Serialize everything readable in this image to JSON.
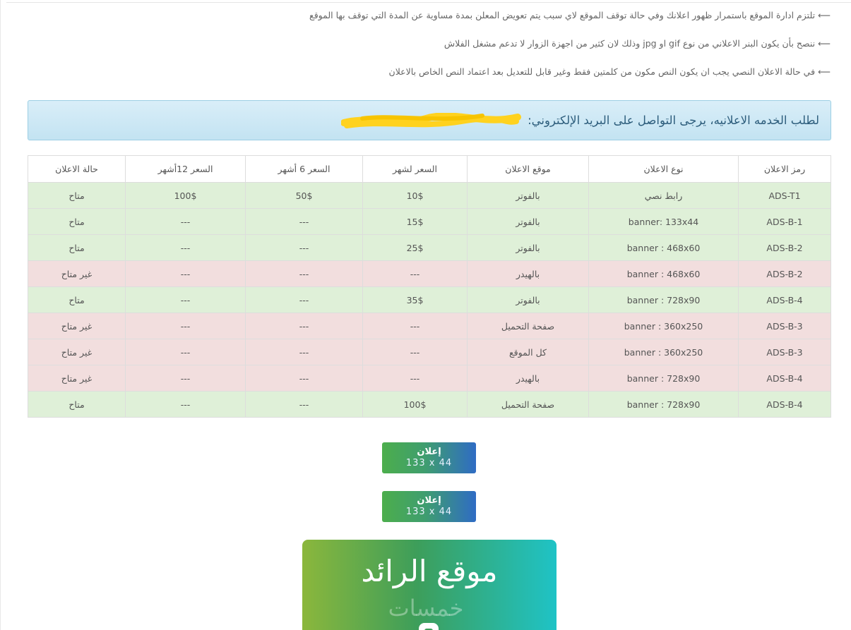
{
  "notes": [
    "تلتزم ادارة الموقع باستمرار ظهور اعلانك وفي حالة توقف الموقع لاي سبب يتم تعويض المعلن بمدة مساوية عن المدة التي توقف بها الموقع",
    "ننصح بأن يكون البنر الاعلاني من نوع gif او jpg وذلك لان كثير من اجهزة الزوار لا تدعم مشغل الفلاش",
    "في حالة الاعلان النصي يجب ان يكون النص مكون من كلمتين فقط وغير قابل للتعديل بعد اعتماد النص الخاص بالاعلان"
  ],
  "note_arrow": "⟵",
  "alert": {
    "text": "لطلب الخدمه الاعلانيه، يرجى التواصل على البريد الإلكتروني:"
  },
  "table": {
    "headers": [
      "رمز الاعلان",
      "نوع الاعلان",
      "موقع الاعلان",
      "السعر لشهر",
      "السعر 6 أشهر",
      "السعر 12أشهر",
      "حالة الاعلان"
    ],
    "rows": [
      {
        "status": "ok",
        "cells": [
          "ADS-T1",
          "رابط نصي",
          "بالفوتر",
          "10$",
          "50$",
          "100$",
          "متاح"
        ]
      },
      {
        "status": "ok",
        "cells": [
          "ADS-B-1",
          "banner: 133x44",
          "بالفوتر",
          "15$",
          "---",
          "---",
          "متاح"
        ]
      },
      {
        "status": "ok",
        "cells": [
          "ADS-B-2",
          "banner : 468x60",
          "بالفوتر",
          "25$",
          "---",
          "---",
          "متاح"
        ]
      },
      {
        "status": "no",
        "cells": [
          "ADS-B-2",
          "banner : 468x60",
          "بالهيدر",
          "---",
          "---",
          "---",
          "غير متاح"
        ]
      },
      {
        "status": "ok",
        "cells": [
          "ADS-B-4",
          "banner : 728x90",
          "بالفوتر",
          "35$",
          "---",
          "---",
          "متاح"
        ]
      },
      {
        "status": "no",
        "cells": [
          "ADS-B-3",
          "banner : 360x250",
          "صفحة التحميل",
          "---",
          "---",
          "---",
          "غير متاح"
        ]
      },
      {
        "status": "no",
        "cells": [
          "ADS-B-3",
          "banner : 360x250",
          "كل الموقع",
          "---",
          "---",
          "---",
          "غير متاح"
        ]
      },
      {
        "status": "no",
        "cells": [
          "ADS-B-4",
          "banner : 728x90",
          "بالهيدر",
          "---",
          "---",
          "---",
          "غير متاح"
        ]
      },
      {
        "status": "ok",
        "cells": [
          "ADS-B-4",
          "banner : 728x90",
          "صفحة التحميل",
          "100$",
          "---",
          "---",
          "متاح"
        ]
      }
    ]
  },
  "banners": [
    {
      "title": "إعلان",
      "size": "133 x 44"
    },
    {
      "title": "إعلان",
      "size": "133 x 44"
    }
  ],
  "promo": {
    "title": "موقع الرائد",
    "logo_text": "خمسات"
  },
  "colors": {
    "available_row": "#dff0d8",
    "unavailable_row": "#f2dede",
    "alert_bg": "#d9eef8",
    "alert_text": "#2d5d7c",
    "redaction": "#ffd21f"
  }
}
